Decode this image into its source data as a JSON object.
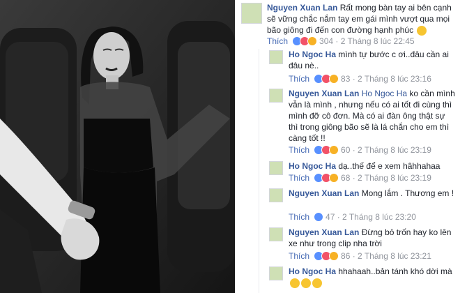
{
  "comments": [
    {
      "author": "Nguyen Xuan Lan",
      "mention": "",
      "text": "Rất mong bàn tay ai bên cạnh sẽ vững chắc nắm tay em gái mình vượt qua mọi bão giông đi đến con đường hạnh phúc",
      "like": "Thích",
      "count": "304",
      "time": "2 Tháng 8 lúc 22:45",
      "emoji": "kiss-emoji"
    },
    {
      "author": "Ho Ngoc Ha",
      "mention": "",
      "text": "mình tự bước c ơi..đâu cần ai đâu nè..",
      "like": "Thích",
      "count": "83",
      "time": "2 Tháng 8 lúc 23:16"
    },
    {
      "author": "Nguyen Xuan Lan",
      "mention": "Ho Ngoc Ha",
      "text": "ko cần mình vẫn là mình , nhưng nếu có ai tốt đi cùng thì mình đỡ cô đơn. Mà có ai đàn ông thật sự thì trong giông bão sẽ là lá chắn cho em thì càng tốt !!",
      "like": "Thích",
      "count": "60",
      "time": "2 Tháng 8 lúc 23:19"
    },
    {
      "author": "Ho Ngoc Ha",
      "mention": "",
      "text": "dạ..thế để e xem hâhhahaa",
      "like": "Thích",
      "count": "68",
      "time": "2 Tháng 8 lúc 23:19"
    },
    {
      "author": "Nguyen Xuan Lan",
      "mention": "",
      "text": "Mong lắm . Thương em !",
      "like": "Thích",
      "count": "47",
      "time": "2 Tháng 8 lúc 23:20"
    },
    {
      "author": "Nguyen Xuan Lan",
      "mention": "",
      "text": "Đừng bỏ trốn hay ko lên xe như trong clip nha trời",
      "like": "Thích",
      "count": "86",
      "time": "2 Tháng 8 lúc 23:21"
    },
    {
      "author": "Ho Ngoc Ha",
      "mention": "",
      "text": "hhahaah..bản tánh khó dời mà",
      "like": "Thích",
      "count": "",
      "time": ""
    }
  ]
}
